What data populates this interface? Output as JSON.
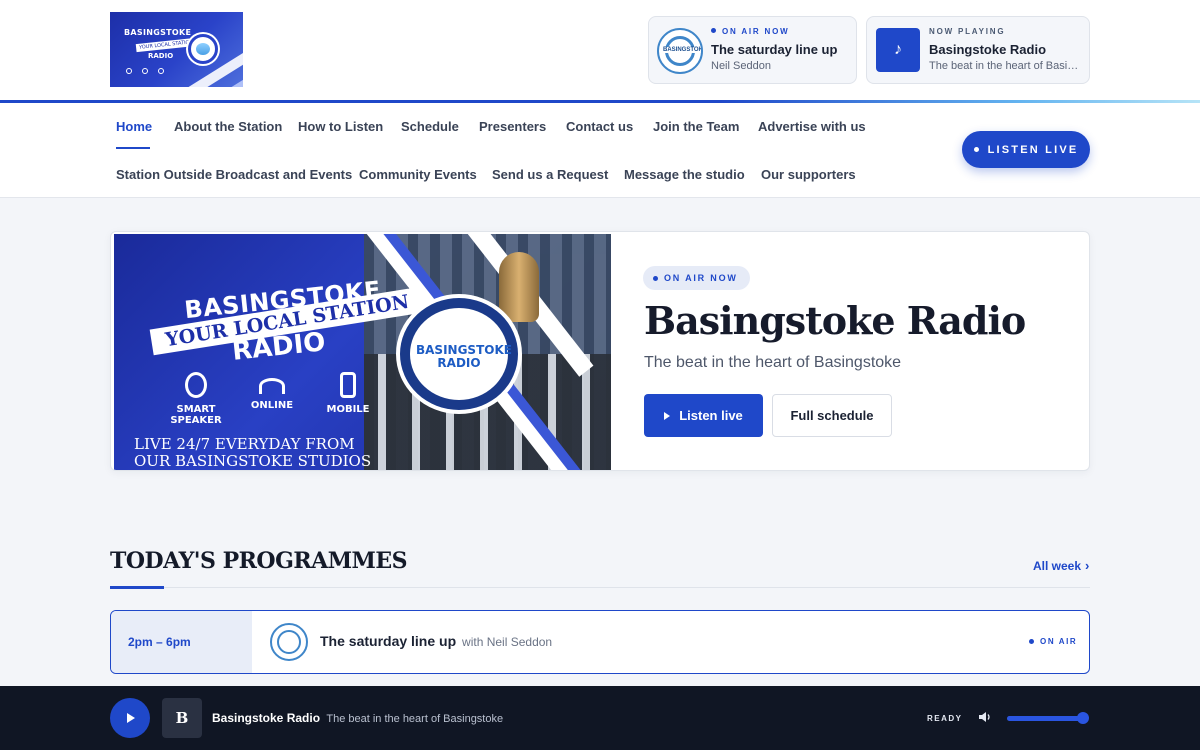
{
  "header": {
    "logo_alt": "Basingstoke Radio",
    "on_air_card": {
      "kicker": "ON AIR NOW",
      "title": "The saturday line up",
      "subtitle": "Neil Seddon"
    },
    "now_playing_card": {
      "kicker": "NOW PLAYING",
      "title": "Basingstoke Radio",
      "subtitle": "The beat in the heart of Basingstoke"
    }
  },
  "nav": {
    "row1": [
      "Home",
      "About the Station",
      "How to Listen",
      "Schedule",
      "Presenters",
      "Contact us",
      "Join the Team",
      "Advertise with us"
    ],
    "row2": [
      "Station Outside Broadcast and Events",
      "Community Events",
      "Send us a Request",
      "Message the studio",
      "Our supporters"
    ],
    "active": "Home",
    "listen_live_label": "LISTEN LIVE"
  },
  "hero": {
    "pill": "ON AIR NOW",
    "title": "Basingstoke Radio",
    "subtitle": "The beat in the heart of Basingstoke",
    "primary_button": "Listen live",
    "secondary_button": "Full schedule",
    "image": {
      "headline": "BASINGSTOKE",
      "banner": "YOUR LOCAL STATION",
      "radio": "RADIO",
      "badge": "BASINGSTOKE RADIO",
      "features": [
        "SMART SPEAKER",
        "ONLINE",
        "MOBILE"
      ],
      "footer_line1": "LIVE 24/7 EVERYDAY FROM",
      "footer_line2": "OUR BASINGSTOKE STUDIOS"
    }
  },
  "programmes": {
    "heading": "TODAY'S PROGRAMMES",
    "all_week": "All week",
    "items": [
      {
        "time": "2pm – 6pm",
        "title": "The saturday line up",
        "with": "with Neil Seddon",
        "status": "ON AIR"
      }
    ]
  },
  "player": {
    "tile_letter": "B",
    "title": "Basingstoke Radio",
    "subtitle": "The beat in the heart of Basingstoke",
    "status": "READY",
    "volume": 0.95
  },
  "colors": {
    "accent": "#1f48c9",
    "player_bg": "#101624",
    "page_bg": "#f3f5f9"
  }
}
